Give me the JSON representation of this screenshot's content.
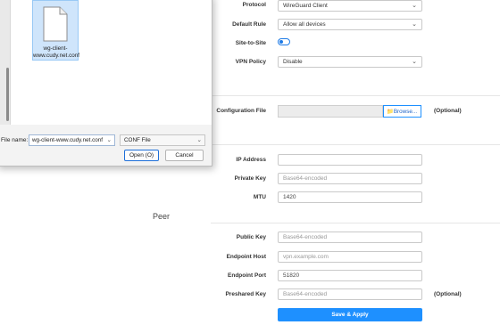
{
  "dialog": {
    "file_item_label": "wg-client-www.cudy.net.conf",
    "filename_label": "File name:",
    "filename_value": "wg-client-www.cudy.net.conf",
    "filetype_value": "CONF File",
    "open_button": "Open (O)",
    "cancel_button": "Cancel"
  },
  "form": {
    "protocol": {
      "label": "Protocol",
      "value": "WireGuard Client"
    },
    "default_rule": {
      "label": "Default Rule",
      "value": "Allow all devices"
    },
    "site_to_site": {
      "label": "Site-to-Site"
    },
    "vpn_policy": {
      "label": "VPN Policy",
      "value": "Disable"
    },
    "config_file": {
      "label": "Configuration File",
      "browse": "Browse...",
      "note": "(Optional)"
    },
    "ip_address": {
      "label": "IP Address",
      "value": ""
    },
    "private_key": {
      "label": "Private Key",
      "placeholder": "Base64-encoded"
    },
    "mtu": {
      "label": "MTU",
      "value": "1420"
    },
    "peer_heading": "Peer",
    "public_key": {
      "label": "Public Key",
      "placeholder": "Base64-encoded"
    },
    "endpoint_host": {
      "label": "Endpoint Host",
      "placeholder": "vpn.example.com"
    },
    "endpoint_port": {
      "label": "Endpoint Port",
      "value": "51820"
    },
    "preshared_key": {
      "label": "Preshared Key",
      "placeholder": "Base64-encoded",
      "note": "(Optional)"
    },
    "save_button": "Save & Apply"
  },
  "colors": {
    "accent": "#1e90ff",
    "toggle": "#1e7be6",
    "selection": "#cfe5fb"
  }
}
